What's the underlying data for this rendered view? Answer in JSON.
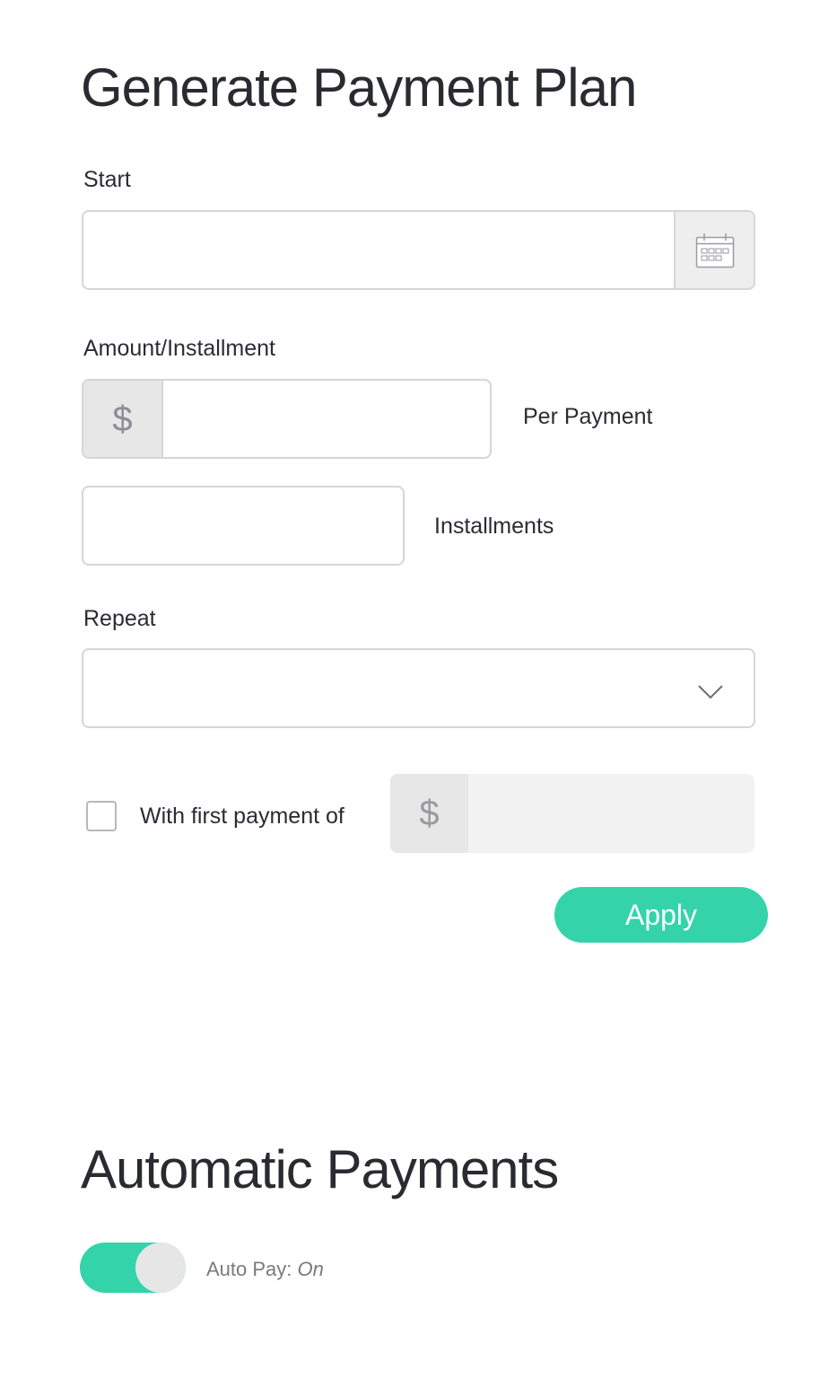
{
  "plan": {
    "title": "Generate Payment Plan",
    "start": {
      "label": "Start",
      "value": "",
      "icon": "calendar-icon"
    },
    "amount": {
      "label": "Amount/Installment",
      "currency_symbol": "$",
      "value": "",
      "suffix": "Per Payment"
    },
    "installments": {
      "value": "",
      "suffix": "Installments"
    },
    "repeat": {
      "label": "Repeat",
      "selected": "",
      "icon": "chevron-down-icon"
    },
    "first_payment": {
      "checked": false,
      "label": "With first payment of",
      "currency_symbol": "$",
      "value": ""
    },
    "apply_label": "Apply"
  },
  "automatic": {
    "title": "Automatic Payments",
    "autopay_label": "Auto Pay:",
    "autopay_state": "On"
  },
  "colors": {
    "accent": "#35d3aa",
    "addon_bg": "#e7e7e7",
    "disabled_bg": "#f2f2f2",
    "border": "#d6d6d6",
    "text": "#2b2c33"
  }
}
